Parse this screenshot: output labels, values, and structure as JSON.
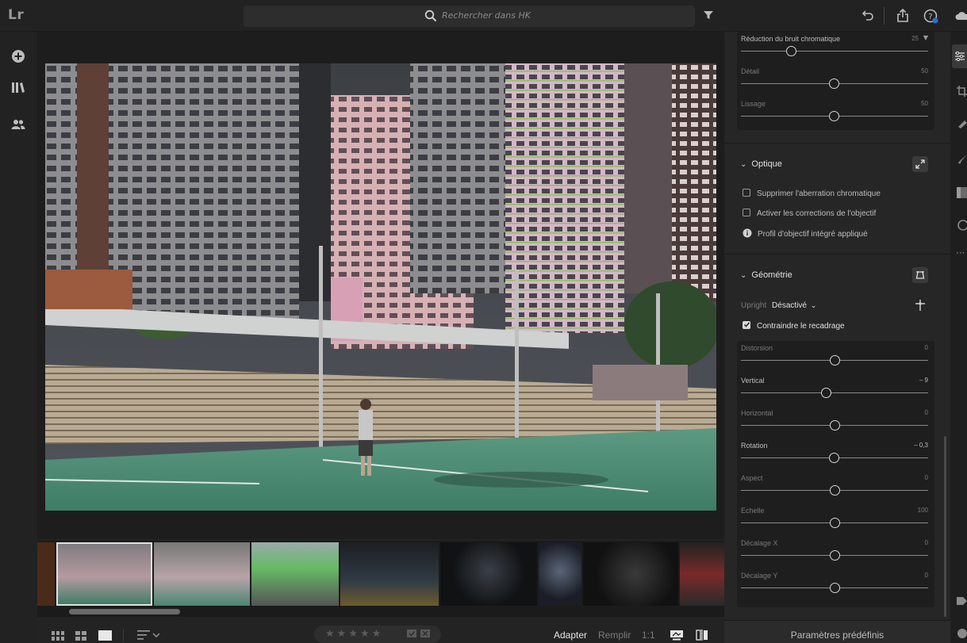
{
  "app": {
    "logo": "Lr"
  },
  "search": {
    "placeholder": "Rechercher dans HK"
  },
  "bottombar": {
    "stars": "★★★★★",
    "fit_options": [
      "Adapter",
      "Remplir",
      "1:1"
    ],
    "active_fit": "Adapter"
  },
  "panel": {
    "noise_card": [
      {
        "label": "Réduction du bruit chromatique",
        "value": "25",
        "has_dropdown": true
      },
      {
        "label": "Détail",
        "value": "50"
      },
      {
        "label": "Lissage",
        "value": "50"
      }
    ],
    "optics": {
      "title": "Optique",
      "remove_ca": "Supprimer l'aberration chromatique",
      "enable_profile": "Activer les corrections de l'objectif",
      "profile_info": "Profil d'objectif intégré appliqué"
    },
    "geometry": {
      "title": "Géométrie",
      "upright_label": "Upright",
      "upright_value": "Désactivé",
      "constrain_crop": "Contraindre le recadrage",
      "constrain_checked": true,
      "sliders": [
        {
          "label": "Distorsion",
          "value": "0",
          "position": 0.5,
          "active": false
        },
        {
          "label": "Vertical",
          "value": "– 9",
          "position": 0.455,
          "active": true
        },
        {
          "label": "Horizontal",
          "value": "0",
          "position": 0.5,
          "active": false
        },
        {
          "label": "Rotation",
          "value": "– 0,3",
          "position": 0.497,
          "active": true
        },
        {
          "label": "Aspect",
          "value": "0",
          "position": 0.5,
          "active": false
        },
        {
          "label": "Echelle",
          "value": "100",
          "position": 0.5,
          "active": false
        },
        {
          "label": "Décalage X",
          "value": "0",
          "position": 0.5,
          "active": false
        },
        {
          "label": "Décalage Y",
          "value": "0",
          "position": 0.5,
          "active": false
        }
      ]
    },
    "presets_label": "Paramètres prédéfinis"
  },
  "colors": {
    "accent": "#4a8fd8",
    "help_badge": "#2d6fcf",
    "court": "#4f8f77"
  }
}
